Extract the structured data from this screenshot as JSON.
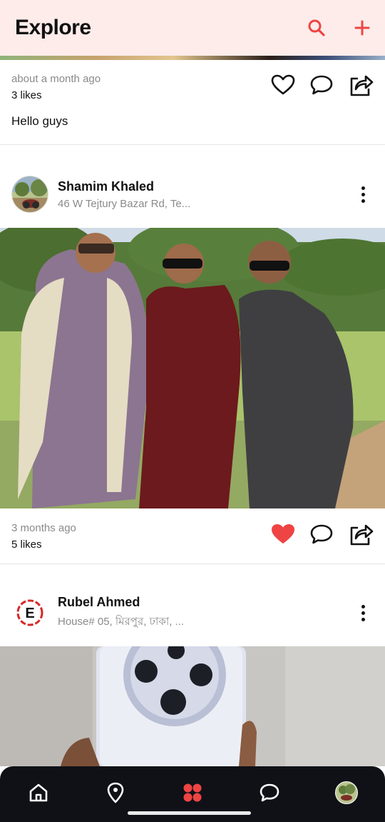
{
  "header": {
    "title": "Explore",
    "search_icon": "search-icon",
    "add_icon": "plus-icon",
    "accent": "#ef4444",
    "background": "#fdecea"
  },
  "posts": [
    {
      "time": "about a month ago",
      "likes": "3 likes",
      "caption": "Hello guys",
      "liked": false
    },
    {
      "author": "Shamim Khaled",
      "location": "46 W Tejtury Bazar Rd, Te...",
      "time": "3 months ago",
      "likes": "5 likes",
      "liked": true
    },
    {
      "author": "Rubel Ahmed",
      "location": "House# 05, মিরপুর, ঢাকা, ..."
    }
  ],
  "nav": {
    "items": [
      "home-icon",
      "location-pin-icon",
      "explore-grid-icon",
      "chat-icon",
      "profile-avatar"
    ],
    "active": "explore-grid-icon",
    "active_color": "#ef4444",
    "background": "#0f1117"
  }
}
